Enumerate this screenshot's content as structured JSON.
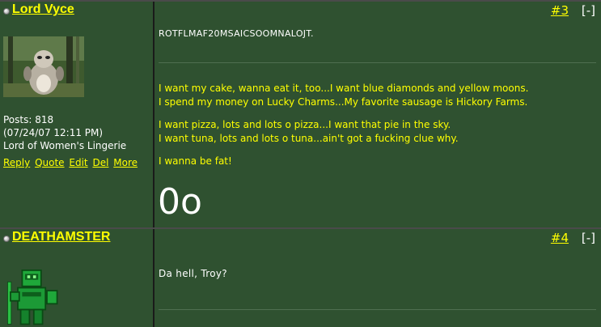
{
  "posts": [
    {
      "username": "Lord Vyce",
      "posts_label": "Posts: 818",
      "joined": "(07/24/07 12:11 PM)",
      "title": "Lord of Women's Lingerie",
      "actions": [
        "Reply",
        "Quote",
        "Edit",
        "Del",
        "More"
      ],
      "post_number": "#3",
      "collapse_label": "[-]",
      "body": "ROTFLMAF20MSAICSOOMNALOJT.",
      "signature": [
        "I want my cake, wanna eat it, too...I want blue diamonds and yellow moons.",
        "I spend my money on Lucky Charms...My favorite sausage is Hickory Farms.",
        "I want pizza, lots and lots o pizza...I want that pie in the sky.",
        "I want tuna, lots and lots o tuna...ain't got a fucking clue why.",
        "I wanna be fat!"
      ],
      "signature_big": "0o"
    },
    {
      "username": "DEATHAMSTER",
      "post_number": "#4",
      "collapse_label": "[-]",
      "body": "Da hell, Troy?"
    }
  ],
  "colors": {
    "post_bg": "#2f5130",
    "link_yellow": "#ffff00",
    "text_white": "#ffffff"
  },
  "icons": [
    "status-dot-icon"
  ]
}
